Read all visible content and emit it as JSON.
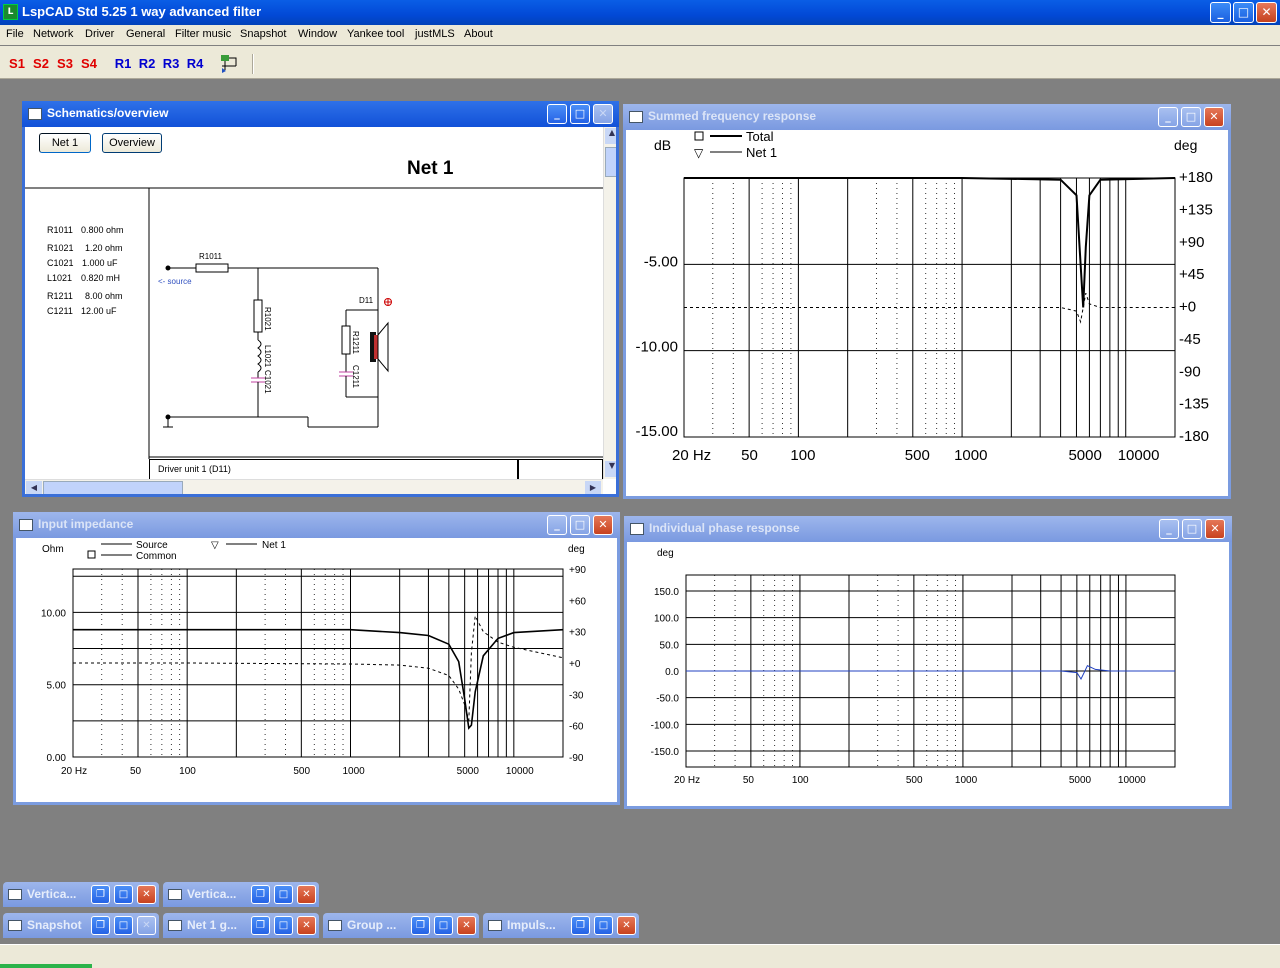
{
  "app": {
    "title": "LspCAD Std 5.25 1 way advanced filter",
    "icon_label": "L"
  },
  "menu": [
    "File",
    "Network",
    "Driver",
    "General",
    "Filter music",
    "Snapshot",
    "Window",
    "Yankee tool",
    "justMLS",
    "About"
  ],
  "toolbar": {
    "s_buttons": [
      "S1",
      "S2",
      "S3",
      "S4"
    ],
    "r_buttons": [
      "R1",
      "R2",
      "R3",
      "R4"
    ],
    "tool_icon": "network-tool-icon"
  },
  "schematics": {
    "title": "Schematics/overview",
    "buttons": [
      "Net 1",
      "Overview"
    ],
    "net_title": "Net 1",
    "components": [
      {
        "name": "R1011",
        "value": "0.800 ohm"
      },
      {
        "name": "R1021",
        "value": "1.20 ohm"
      },
      {
        "name": "C1021",
        "value": "1.000 uF"
      },
      {
        "name": "L1021",
        "value": "0.820 mH"
      },
      {
        "name": "R1211",
        "value": "8.00 ohm"
      },
      {
        "name": "C1211",
        "value": "12.00 uF"
      }
    ],
    "labels": {
      "r1011": "R1011",
      "source": "<- source",
      "r1021": "R1021",
      "l1021": "L1021",
      "c1021": "C1021",
      "d11": "D11",
      "r1211": "R1211",
      "c1211": "C1211"
    },
    "driver_tab": "Driver unit 1 (D11)"
  },
  "summed": {
    "title": "Summed frequency response",
    "legend": [
      "Total",
      "Net 1"
    ],
    "left_unit": "dB",
    "right_unit": "deg",
    "y_ticks": [
      "-5.00",
      "-10.00",
      "-15.00"
    ],
    "phase_ticks": [
      "+180",
      "+135",
      "+90",
      "+45",
      "+0",
      "-45",
      "-90",
      "-135",
      "-180"
    ],
    "x_ticks": [
      "20 Hz",
      "50",
      "100",
      "500",
      "1000",
      "5000",
      "10000"
    ]
  },
  "impedance": {
    "title": "Input impedance",
    "legend": [
      "Source",
      "Common",
      "Net 1"
    ],
    "left_unit": "Ohm",
    "right_unit": "deg",
    "y_ticks": [
      "10.00",
      "5.00",
      "0.00"
    ],
    "phase_ticks": [
      "+90",
      "+60",
      "+30",
      "+0",
      "-30",
      "-60",
      "-90"
    ],
    "x_ticks": [
      "20 Hz",
      "50",
      "100",
      "500",
      "1000",
      "5000",
      "10000"
    ]
  },
  "phase": {
    "title": "Individual phase response",
    "left_unit": "deg",
    "y_ticks": [
      "150.0",
      "100.0",
      "50.0",
      "0.0",
      "-50.0",
      "-100.0",
      "-150.0"
    ],
    "x_ticks": [
      "20 Hz",
      "50",
      "100",
      "500",
      "1000",
      "5000",
      "10000"
    ]
  },
  "minimized": [
    {
      "title": "Vertica..."
    },
    {
      "title": "Vertica..."
    },
    {
      "title": "Snapshot"
    },
    {
      "title": "Net 1 g..."
    },
    {
      "title": "Group ..."
    },
    {
      "title": "Impuls..."
    }
  ],
  "chart_data": [
    {
      "type": "line",
      "title": "Summed frequency response",
      "xlabel": "",
      "ylabel": "dB",
      "x_scale": "log",
      "xlim": [
        20,
        20000
      ],
      "ylim": [
        -15,
        0
      ],
      "y2label": "deg",
      "y2lim": [
        -180,
        180
      ],
      "series": [
        {
          "name": "Total",
          "x": [
            20,
            1000,
            4000,
            5000,
            5300,
            5500,
            5700,
            6000,
            7000,
            20000
          ],
          "values": [
            0,
            0,
            -0.1,
            -1,
            -5,
            -7.5,
            -4,
            -1,
            -0.1,
            0
          ]
        },
        {
          "name": "Net 1",
          "axis": "deg",
          "x": [
            20,
            1000,
            4000,
            5000,
            5300,
            5500,
            5700,
            6000,
            7000,
            20000
          ],
          "values": [
            0,
            0,
            0,
            -5,
            -20,
            0,
            20,
            5,
            0,
            0
          ]
        }
      ]
    },
    {
      "type": "line",
      "title": "Input impedance",
      "xlabel": "",
      "ylabel": "Ohm",
      "x_scale": "log",
      "xlim": [
        20,
        20000
      ],
      "ylim": [
        0,
        13
      ],
      "y2label": "deg",
      "y2lim": [
        -90,
        90
      ],
      "series": [
        {
          "name": "Source",
          "x": [
            20,
            100,
            1000,
            2000,
            3000,
            4000,
            4600,
            5000,
            5300,
            5500,
            5800,
            6500,
            8000,
            10000,
            20000
          ],
          "values": [
            8.8,
            8.8,
            8.8,
            8.6,
            8.4,
            7.8,
            6.6,
            4.0,
            2.0,
            2.2,
            4.5,
            7.0,
            8.2,
            8.6,
            8.8
          ]
        },
        {
          "name": "Net 1",
          "axis": "deg",
          "x": [
            20,
            100,
            1000,
            2000,
            3000,
            4000,
            4600,
            5000,
            5300,
            5500,
            5800,
            6500,
            8000,
            10000,
            20000
          ],
          "values": [
            0,
            0,
            -1,
            -2,
            -5,
            -12,
            -25,
            -40,
            -55,
            10,
            45,
            30,
            20,
            15,
            5
          ]
        }
      ]
    },
    {
      "type": "line",
      "title": "Individual phase response",
      "xlabel": "",
      "ylabel": "deg",
      "x_scale": "log",
      "xlim": [
        20,
        20000
      ],
      "ylim": [
        -180,
        180
      ],
      "series": [
        {
          "name": "Net 1",
          "x": [
            20,
            1000,
            4000,
            5000,
            5300,
            5500,
            5800,
            6500,
            8000,
            20000
          ],
          "values": [
            0,
            0,
            0,
            -3,
            -15,
            -5,
            10,
            3,
            0,
            0
          ]
        }
      ]
    }
  ]
}
